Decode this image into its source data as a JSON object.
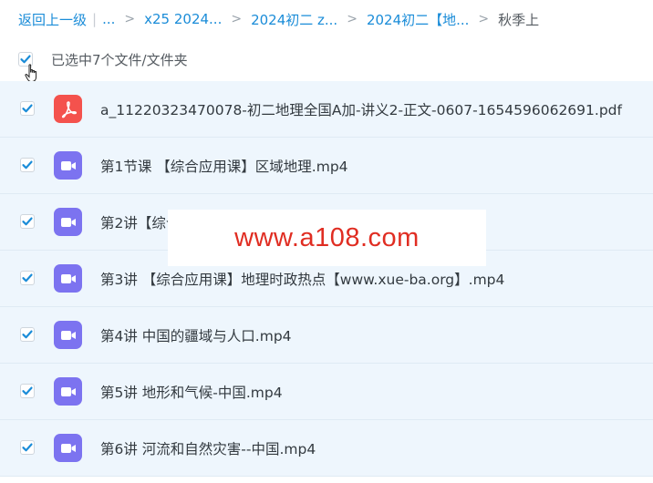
{
  "breadcrumb": {
    "back": "返回上一级",
    "ellipsis": "...",
    "items": [
      "x25 2024...",
      "2024初二 z...",
      "2024初二【地..."
    ],
    "current": "秋季上"
  },
  "selection": {
    "label": "已选中7个文件/文件夹",
    "checked": true
  },
  "files": [
    {
      "name": "a_11220323470078-初二地理全国A加-讲义2-正文-0607-1654596062691.pdf",
      "type": "pdf",
      "icon": "pdf-icon",
      "checked": true
    },
    {
      "name": "第1节课 【综合应用课】区域地理.mp4",
      "type": "video",
      "icon": "video-icon",
      "checked": true
    },
    {
      "name": "第2讲【综合应用课】",
      "type": "video",
      "icon": "video-icon",
      "checked": true
    },
    {
      "name": "第3讲 【综合应用课】地理时政热点【www.xue-ba.org】.mp4",
      "type": "video",
      "icon": "video-icon",
      "checked": true
    },
    {
      "name": "第4讲 中国的疆域与人口.mp4",
      "type": "video",
      "icon": "video-icon",
      "checked": true
    },
    {
      "name": "第5讲 地形和气候-中国.mp4",
      "type": "video",
      "icon": "video-icon",
      "checked": true
    },
    {
      "name": "第6讲 河流和自然灾害--中国.mp4",
      "type": "video",
      "icon": "video-icon",
      "checked": true
    }
  ],
  "watermark": "www.a108.com",
  "colors": {
    "link": "#1a8cd8",
    "row_bg": "#eef6fd",
    "checkbox_check": "#1a8cd8",
    "pdf_icon": "#f4524d",
    "video_icon": "#7c73f0",
    "watermark": "#e02d22"
  }
}
